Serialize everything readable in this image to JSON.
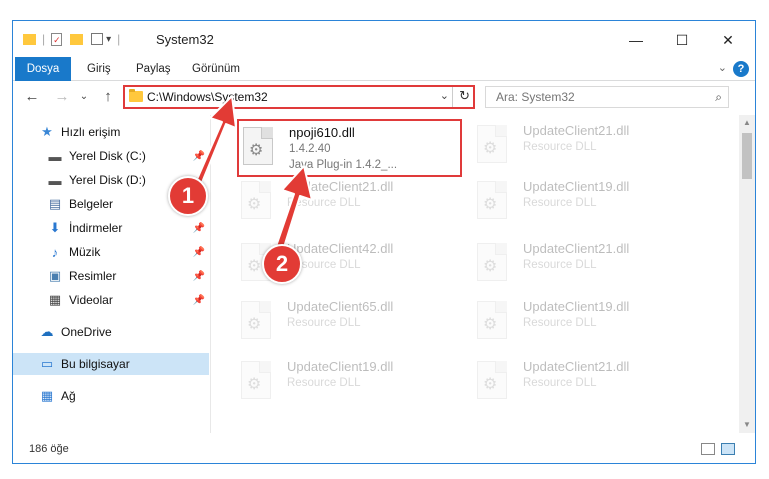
{
  "window": {
    "title": "System32",
    "controls": {
      "minimize": "—",
      "maximize": "☐",
      "close": "✕"
    }
  },
  "quick_access_toolbar": {
    "dropdown": "▾",
    "separator": "|"
  },
  "ribbon": {
    "tabs": [
      "Dosya",
      "Giriş",
      "Paylaş",
      "Görünüm"
    ],
    "collapse": "⌄",
    "help": "?"
  },
  "navbar": {
    "back": "←",
    "forward": "→",
    "recent": "⌄",
    "up": "↑",
    "address_path": "C:\\Windows\\System32",
    "address_dropdown": "⌄",
    "refresh": "↻",
    "search_placeholder": "Ara: System32",
    "search_icon": "⌕"
  },
  "sidebar": {
    "items": [
      {
        "label": "Hızlı erişim",
        "icon": "star-icon",
        "glyph": "★",
        "color": "#3a87d6",
        "pinned": false
      },
      {
        "label": "Yerel Disk (C:)",
        "icon": "drive-icon",
        "glyph": "▬",
        "color": "#555555",
        "pinned": true
      },
      {
        "label": "Yerel Disk (D:)",
        "icon": "drive-icon",
        "glyph": "▬",
        "color": "#555555",
        "pinned": true
      },
      {
        "label": "Belgeler",
        "icon": "documents-icon",
        "glyph": "▤",
        "color": "#4a6fa0",
        "pinned": true
      },
      {
        "label": "İndirmeler",
        "icon": "download-icon",
        "glyph": "⬇",
        "color": "#2a78d0",
        "pinned": true
      },
      {
        "label": "Müzik",
        "icon": "music-icon",
        "glyph": "♪",
        "color": "#2a78d0",
        "pinned": true
      },
      {
        "label": "Resimler",
        "icon": "pictures-icon",
        "glyph": "▣",
        "color": "#4a7fb0",
        "pinned": true
      },
      {
        "label": "Videolar",
        "icon": "videos-icon",
        "glyph": "▦",
        "color": "#444444",
        "pinned": true
      },
      {
        "label": "OneDrive",
        "icon": "cloud-icon",
        "glyph": "☁",
        "color": "#1e6fbf",
        "pinned": false
      },
      {
        "label": "Bu bilgisayar",
        "icon": "computer-icon",
        "glyph": "▭",
        "color": "#2a78d0",
        "pinned": false,
        "selected": true
      },
      {
        "label": "Ağ",
        "icon": "network-icon",
        "glyph": "▦",
        "color": "#2a78d0",
        "pinned": false
      }
    ],
    "pin_glyph": "📌"
  },
  "files": [
    {
      "name": "npoji610.dll",
      "version": "1.4.2.40",
      "description": "Java Plug-in 1.4.2_...",
      "highlighted": true
    },
    {
      "name": "UpdateClient21.dll",
      "version": "",
      "description": "Resource DLL",
      "highlighted": false
    },
    {
      "name": "UpdateClient21.dll",
      "version": "",
      "description": "Resource DLL",
      "highlighted": false
    },
    {
      "name": "UpdateClient19.dll",
      "version": "",
      "description": "Resource DLL",
      "highlighted": false
    },
    {
      "name": "UpdateClient42.dll",
      "version": "",
      "description": "Resource DLL",
      "highlighted": false
    },
    {
      "name": "UpdateClient21.dll",
      "version": "",
      "description": "Resource DLL",
      "highlighted": false
    },
    {
      "name": "UpdateClient65.dll",
      "version": "",
      "description": "Resource DLL",
      "highlighted": false
    },
    {
      "name": "UpdateClient19.dll",
      "version": "",
      "description": "Resource DLL",
      "highlighted": false
    },
    {
      "name": "UpdateClient19.dll",
      "version": "",
      "description": "Resource DLL",
      "highlighted": false
    },
    {
      "name": "UpdateClient21.dll",
      "version": "",
      "description": "Resource DLL",
      "highlighted": false
    }
  ],
  "statusbar": {
    "item_count": "186 öğe"
  },
  "annotations": {
    "step1": "1",
    "step2": "2"
  },
  "colors": {
    "accent": "#1979ca",
    "highlight_border": "#e03a3a",
    "badge": "#e23b35"
  }
}
